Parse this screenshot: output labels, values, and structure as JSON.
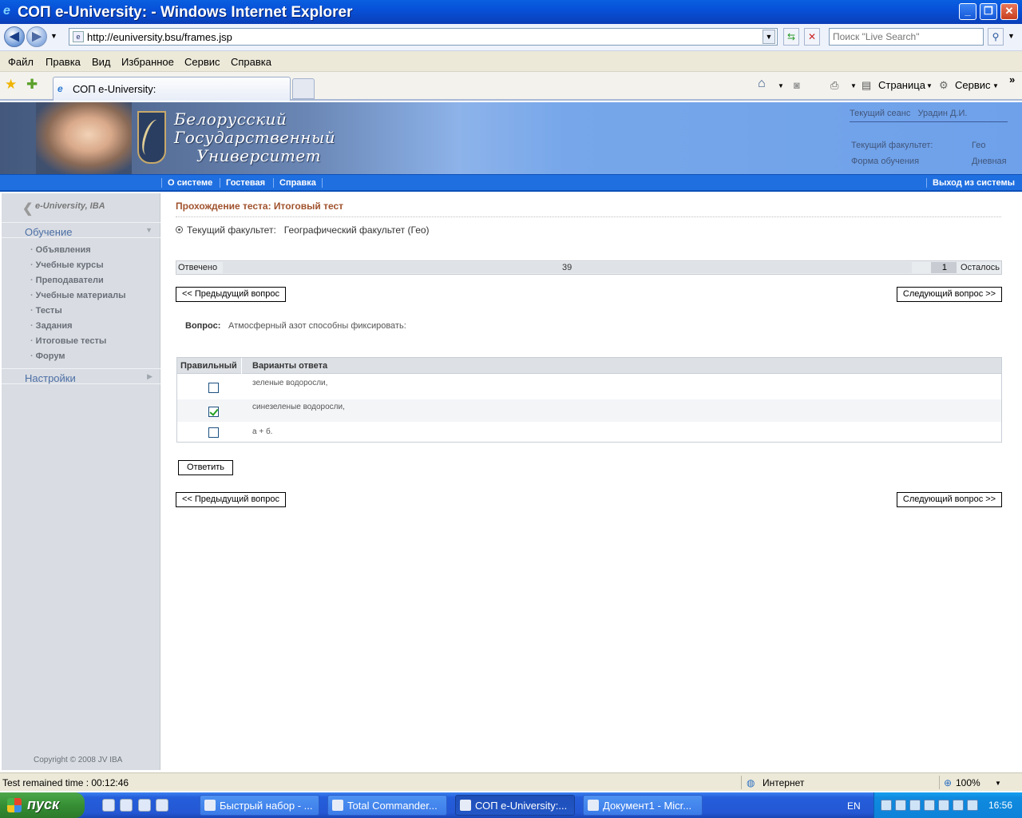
{
  "window": {
    "title": "СОП e-University:  - Windows Internet Explorer",
    "ie_glyph": "e"
  },
  "address": {
    "url": "http://euniversity.bsu/frames.jsp",
    "search_placeholder": "Поиск \"Live Search\""
  },
  "menu": [
    "Файл",
    "Правка",
    "Вид",
    "Избранное",
    "Сервис",
    "Справка"
  ],
  "tab": {
    "label": "СОП e-University:"
  },
  "tools": {
    "page": "Страница",
    "service": "Сервис"
  },
  "header": {
    "university_lines": [
      "Белорусский",
      "Государственный",
      "Университет"
    ],
    "session_label": "Текущий сеанс",
    "session_user": "Урадин Д.И.",
    "faculty_label": "Текущий факультет:",
    "faculty_value": "Гео",
    "form_label": "Форма обучения",
    "form_value": "Дневная"
  },
  "nav": {
    "about": "О системе",
    "guest": "Гостевая",
    "help": "Справка",
    "logout": "Выход из системы"
  },
  "sidebar": {
    "logo": "e-University, IBA",
    "learning": "Обучение",
    "items": [
      "Объявления",
      "Учебные курсы",
      "Преподаватели",
      "Учебные материалы",
      "Тесты",
      "Задания",
      "Итоговые тесты",
      "Форум"
    ],
    "settings": "Настройки",
    "copyright": "Copyright © 2008 JV IBA"
  },
  "main": {
    "title": "Прохождение теста: Итоговый тест",
    "faculty_label": "Текущий факультет:",
    "faculty_value": "Географический факультет (Гео)",
    "progress": {
      "answered_label": "Отвечено",
      "answered": "39",
      "remaining": "1",
      "remaining_label": "Осталось",
      "answered_fraction": 0.975
    },
    "prev_button": "<< Предыдущий вопрос",
    "next_button": "Следующий вопрос >>",
    "question_label": "Вопрос:",
    "question_text": "Атмосферный азот способны фиксировать:",
    "answers_header": {
      "correct": "Правильный",
      "variants": "Варианты ответа"
    },
    "answers": [
      {
        "text": "зеленые водоросли,",
        "checked": false
      },
      {
        "text": "синезеленые водоросли,",
        "checked": true
      },
      {
        "text": "а + б.",
        "checked": false
      }
    ],
    "submit_button": "Ответить"
  },
  "statusbar": {
    "timer": "Test remained time :  00:12:46",
    "zone": "Интернет",
    "zoom": "100%"
  },
  "taskbar": {
    "start": "пуск",
    "tasks": [
      "Быстрый набор - ...",
      "Total Commander...",
      "СОП e-University:...",
      "Документ1 - Micr..."
    ],
    "lang": "EN",
    "clock": "16:56"
  }
}
